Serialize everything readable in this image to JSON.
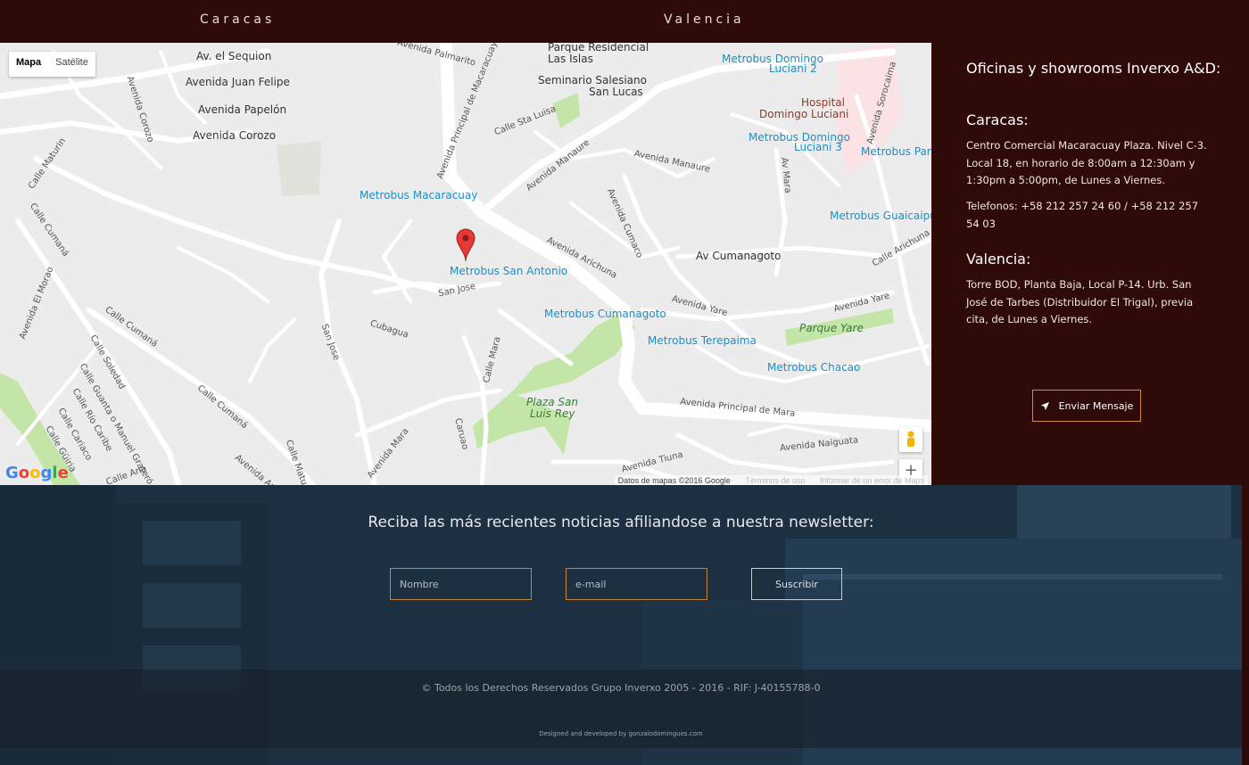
{
  "tabs": {
    "caracas": "Caracas",
    "valencia": "Valencia"
  },
  "map": {
    "type_map": "Mapa",
    "type_satellite": "Satélite",
    "labels": {
      "av_sequion": "Av. el Sequion",
      "av_juan_felipe": "Avenida Juan Felipe",
      "av_papelon": "Avenida Papelón",
      "av_corozo": "Avenida Corozo",
      "av_corozo_v": "Avenida Corozo",
      "av_palmarito": "Avenida Palmarito",
      "parque_residencial": "Parque Residencial",
      "las_islas": "Las Islas",
      "seminario": "Seminario Salesiano",
      "san_lucas": "San Lucas",
      "calle_sta_luisa": "Calle Sta Luisa",
      "av_principal_macaracuay": "Avenida Principal de Macaracuay",
      "metrobus_macaracuay": "Metrobus Macaracuay",
      "metrobus_san_antonio": "Metrobus San Antonio",
      "av_manaure": "Avenida Manaure",
      "av_manaure2": "Avenida Manaure",
      "av_cumaco": "Avenida Cumaco",
      "av_arichuna": "Avenida Arichuna",
      "av_cumanagoto": "Av Cumanagoto",
      "calle_arichuna": "Calle Arichuna",
      "av_yare": "Avenida Yare",
      "av_yare2": "Avenida Yare",
      "parque_yare": "Parque Yare",
      "metrobus_cumanagoto": "Metrobus Cumanagoto",
      "metrobus_terepaima": "Metrobus Terepaima",
      "metrobus_chacao": "Metrobus Chacao",
      "metrobus_guaicaipuro": "Metrobus Guaicaipuro",
      "metrobus_luciani2": "Metrobus Domingo",
      "metrobus_luciani2b": "Luciani 2",
      "metrobus_luciani3": "Metrobus Domingo",
      "metrobus_luciani3b": "Luciani 3",
      "metrobus_paran": "Metrobus Paran",
      "hospital": "Hospital",
      "hospital2": "Domingo Luciani",
      "av_sorocaima": "Avenida Sorocaima",
      "av_mara": "Av Mara",
      "calle_maturin": "Calle Maturin",
      "calle_cumana": "Calle Cumaná",
      "av_el_morao": "Avenida El Morao",
      "calle_cumana2": "Calle Cumaná",
      "calle_cumana3": "Calle Cumaná",
      "calle_soledad": "Calle Soledad",
      "calle_guanta": "Calle Guanta o Manuel Grateró",
      "calle_rio_caribe": "Calle Río Caribe",
      "calle_cariaco": "Calle Cariaco",
      "calle_guiria": "Calle Güiria",
      "san_jose": "San Jose",
      "san_jose_v": "San Jose",
      "cubagua": "Cubagua",
      "calle_mara": "Calle Mara",
      "caruao": "Caruao",
      "av_mara2": "Avenida Mara",
      "plaza_san_luis": "Plaza San",
      "plaza_san_luis2": "Luis Rey",
      "av_principal_mara": "Avenida Principal de Mara",
      "av_naiguata": "Avenida Naiguata",
      "av_tiuna": "Avenida Tiuna",
      "calle_ana": "Calle Ana",
      "calle_matu": "Calle Matu",
      "av_aruna": "Avenida Aruna"
    },
    "google_logo": "Google",
    "attribution": "Datos de mapas ©2016 Google",
    "attribution_terms": "Términos de uso",
    "attribution_report": "Informar de un error de Maps",
    "zoom_in": "+",
    "zoom_out": "−"
  },
  "info": {
    "heading": "Oficinas y showrooms Inverxo A&D:",
    "caracas_title": "Caracas:",
    "caracas_address": "Centro Comercial Macaracuay Plaza. Nivel C-3. Local 18, en horario de 8:00am a 12:30am y 1:30pm a 5:00pm, de Lunes a Viernes.",
    "caracas_phones": "Telefonos: +58 212 257 24 60  / +58 212 257 54 03",
    "valencia_title": "Valencia:",
    "valencia_address": "Torre BOD, Planta Baja, Local P-14. Urb. San José de Tarbes (Distribuidor El Trigal), previa cita, de Lunes a Viernes.",
    "send_button": "Enviar Mensaje"
  },
  "newsletter": {
    "title": "Reciba las más recientes noticias afiliandose a nuestra newsletter:",
    "name_placeholder": "Nombre",
    "email_placeholder": "e-mail",
    "submit": "Suscribir"
  },
  "footer": {
    "copyright": "© Todos los Derechos Reservados Grupo Inverxo 2005 - 2016 - RIF: J-40155788-0",
    "credits": "Designed and developed by gonzalodomingues.com"
  },
  "colors": {
    "header_bg": "#2e0b09",
    "accent": "#d7893a",
    "park": "#c3e6a8",
    "transit_blue": "#1a8fc6",
    "pin_red": "#e53935"
  }
}
